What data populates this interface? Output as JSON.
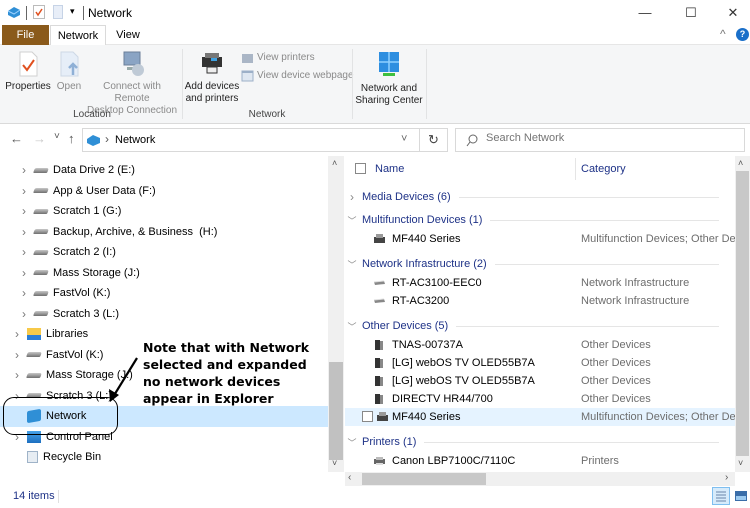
{
  "window": {
    "title": "Network",
    "minimize": "—",
    "maximize": "☐",
    "close": "✕"
  },
  "ribbon_tabs": [
    {
      "label": "File"
    },
    {
      "label": "Network"
    },
    {
      "label": "View"
    }
  ],
  "ribbon": {
    "location_group": "Location",
    "network_group": "Network",
    "properties": "Properties",
    "open": "Open",
    "remote_line1": "Connect with Remote",
    "remote_line2": "Desktop Connection",
    "add_line1": "Add devices",
    "add_line2": "and printers",
    "view_printers": "View printers",
    "view_webpage": "View device webpage",
    "nsc_line1": "Network and",
    "nsc_line2": "Sharing Center",
    "collapse_icon": "^",
    "help_icon": "?"
  },
  "nav": {
    "back": "←",
    "forward": "→",
    "recent": "˅",
    "up": "↑",
    "breadcrumb_sep": "›",
    "location": "Network",
    "dropdown": "˅",
    "refresh": "↻",
    "search_placeholder": "Search Network"
  },
  "tree": [
    {
      "label": "Data Drive 2 (E:)",
      "type": "drive",
      "indent": 2
    },
    {
      "label": "App & User Data (F:)",
      "type": "drive",
      "indent": 2
    },
    {
      "label": "Scratch 1 (G:)",
      "type": "drive",
      "indent": 2
    },
    {
      "label": "Backup, Archive, & Business  (H:)",
      "type": "drive",
      "indent": 2
    },
    {
      "label": "Scratch 2 (I:)",
      "type": "drive",
      "indent": 2
    },
    {
      "label": "Mass Storage (J:)",
      "type": "drive",
      "indent": 2
    },
    {
      "label": "FastVol (K:)",
      "type": "drive",
      "indent": 2
    },
    {
      "label": "Scratch 3 (L:)",
      "type": "drive",
      "indent": 2
    },
    {
      "label": "Libraries",
      "type": "libraries",
      "indent": 1
    },
    {
      "label": "FastVol (K:)",
      "type": "drive",
      "indent": 1
    },
    {
      "label": "Mass Storage (J:)",
      "type": "drive",
      "indent": 1
    },
    {
      "label": "Scratch 3 (L:)",
      "type": "drive",
      "indent": 1
    },
    {
      "label": "Network",
      "type": "network",
      "indent": 1,
      "selected": true,
      "nochev": true
    },
    {
      "label": "Control Panel",
      "type": "control",
      "indent": 1
    },
    {
      "label": "Recycle Bin",
      "type": "recycle",
      "indent": 1,
      "nochev": true
    }
  ],
  "annotation": {
    "lines": [
      "Note that with Network",
      "selected and expanded",
      "no network devices",
      "appear in Explorer"
    ]
  },
  "columns": {
    "name": "Name",
    "category": "Category"
  },
  "groups": [
    {
      "label": "Media Devices (6)",
      "expanded": false,
      "items": []
    },
    {
      "label": "Multifunction Devices (1)",
      "expanded": true,
      "items": [
        {
          "name": "MF440 Series",
          "category": "Multifunction Devices; Other Devices",
          "icon": "mfp"
        }
      ]
    },
    {
      "label": "Network Infrastructure (2)",
      "expanded": true,
      "items": [
        {
          "name": "RT-AC3100-EEC0",
          "category": "Network Infrastructure",
          "icon": "router"
        },
        {
          "name": "RT-AC3200",
          "category": "Network Infrastructure",
          "icon": "router"
        }
      ]
    },
    {
      "label": "Other Devices (5)",
      "expanded": true,
      "items": [
        {
          "name": "TNAS-00737A",
          "category": "Other Devices",
          "icon": "device"
        },
        {
          "name": "[LG] webOS TV OLED55B7A",
          "category": "Other Devices",
          "icon": "device"
        },
        {
          "name": "[LG] webOS TV OLED55B7A",
          "category": "Other Devices",
          "icon": "device"
        },
        {
          "name": "DIRECTV HR44/700",
          "category": "Other Devices",
          "icon": "device"
        },
        {
          "name": "MF440 Series",
          "category": "Multifunction Devices; Other Devices",
          "icon": "mfp",
          "hover": true
        }
      ]
    },
    {
      "label": "Printers (1)",
      "expanded": true,
      "items": [
        {
          "name": "Canon LBP7100C/7110C",
          "category": "Printers",
          "icon": "printer"
        }
      ]
    }
  ],
  "status": {
    "count": "14 items"
  },
  "colors": {
    "file_tab": "#8a5a1b",
    "selection": "#cce8ff",
    "group_header": "#1e3287"
  }
}
